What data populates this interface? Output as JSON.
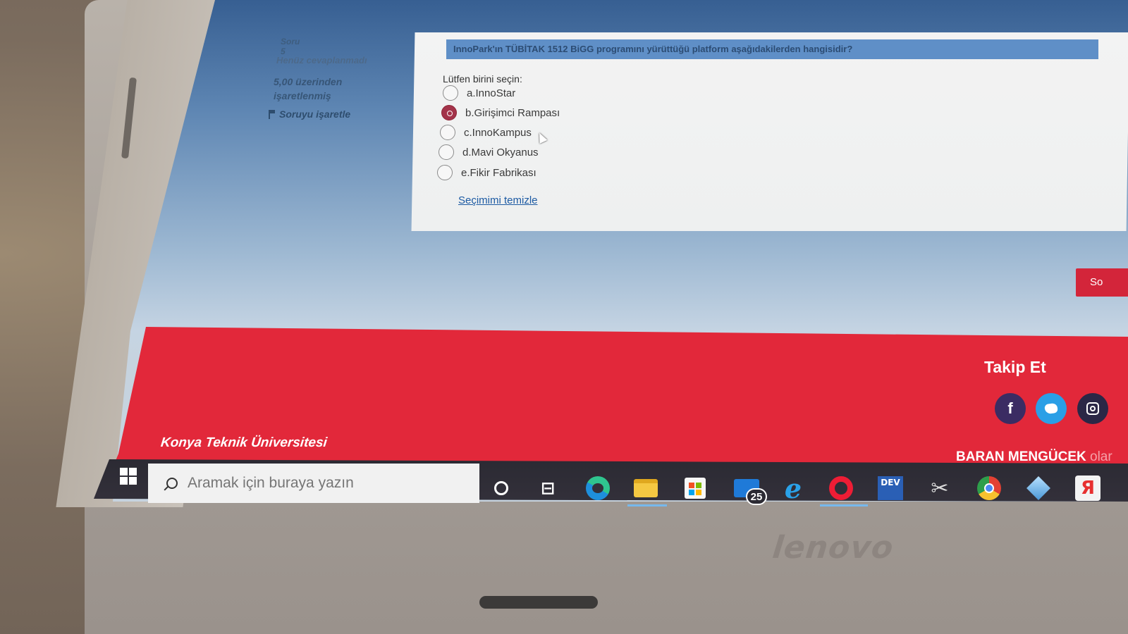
{
  "quiz": {
    "question_number": "Soru 5",
    "status": "Henüz cevaplanmadı",
    "mark_line1": "5,00 üzerinden",
    "mark_line2": "işaretlenmiş",
    "flag_label": "Soruyu işaretle",
    "question_text": "InnoPark'ın TÜBİTAK 1512 BiGG programını yürüttüğü platform aşağıdakilerden hangisidir?",
    "prompt": "Lütfen birini seçin:",
    "options": [
      {
        "label": "a.InnoStar",
        "selected": false
      },
      {
        "label": "b.Girişimci Rampası",
        "selected": true
      },
      {
        "label": "c.InnoKampus",
        "selected": false
      },
      {
        "label": "d.Mavi Okyanus",
        "selected": false
      },
      {
        "label": "e.Fikir Fabrikası",
        "selected": false
      }
    ],
    "clear_label": "Seçimimi temizle",
    "next_label": "So"
  },
  "footer": {
    "follow_title": "Takip Et",
    "university": "Konya Teknik Üniversitesi",
    "owner_name": "BARAN MENGÜCEK",
    "owner_suffix": "olar",
    "social_icons": [
      "facebook-icon",
      "twitter-icon",
      "instagram-icon"
    ]
  },
  "taskbar": {
    "search_placeholder": "Aramak için buraya yazın",
    "mail_badge": "25",
    "devcpp_label": "DEV",
    "yandex_label": "Я",
    "apps": [
      "cortana",
      "task-view",
      "edge",
      "file-explorer",
      "store",
      "mail",
      "internet-explorer",
      "opera",
      "dev-cpp",
      "snipping-tool",
      "chrome",
      "cube-app",
      "yandex"
    ]
  },
  "device": {
    "brand": "lenovo"
  },
  "colors": {
    "footer_red": "#e2283a",
    "selected_radio": "#a3334a",
    "question_bar": "#5f8fc7",
    "link_blue": "#1c5aa3"
  }
}
